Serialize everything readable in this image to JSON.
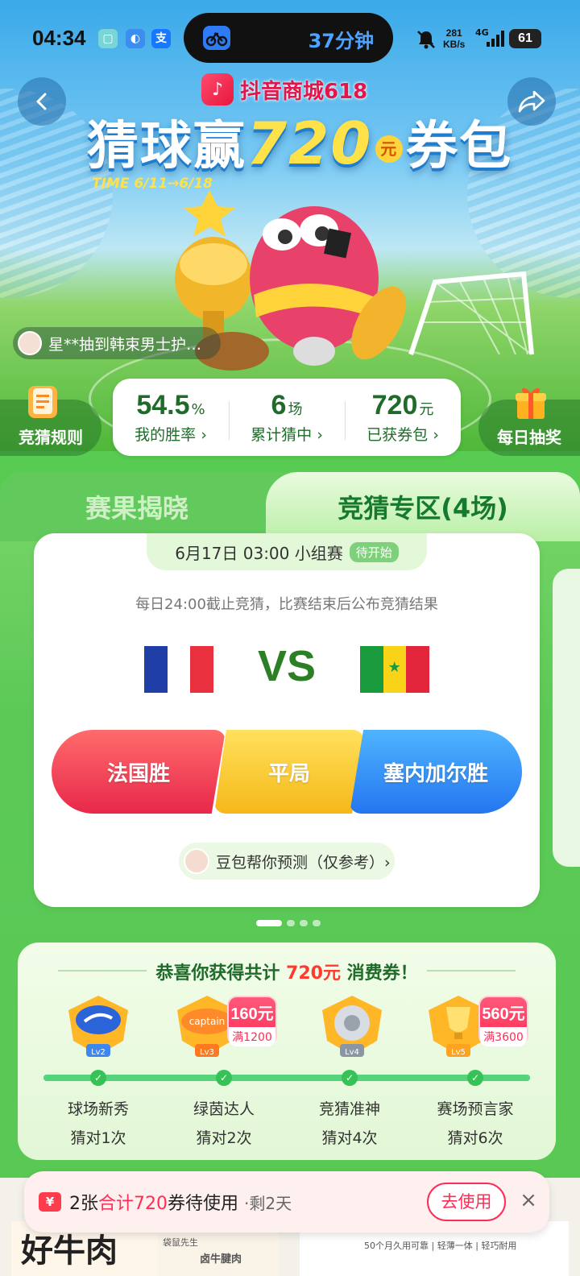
{
  "status_bar": {
    "time": "04:34",
    "timer": "37分钟",
    "network_speed_value": "281",
    "network_speed_unit": "KB/s",
    "network_type": "4G",
    "battery": "61"
  },
  "hero": {
    "brand": "抖音商城618",
    "headline_prefix": "猜球赢",
    "headline_number": "720",
    "headline_yuan": "元",
    "headline_suffix": "券包",
    "time_range": "TIME 6/11→6/18",
    "ticker": "星**抽到韩束男士护…"
  },
  "side_buttons": {
    "rules": "竞猜规则",
    "lottery": "每日抽奖"
  },
  "stats": [
    {
      "value": "54.5",
      "unit": "%",
      "label": "我的胜率 ›"
    },
    {
      "value": "6",
      "unit": "场",
      "label": "累计猜中 ›"
    },
    {
      "value": "720",
      "unit": "元",
      "label": "已获券包 ›"
    }
  ],
  "tabs": {
    "results": "赛果揭晓",
    "guess": "竞猜专区(4场)"
  },
  "match": {
    "datetime": "6月17日 03:00 小组赛",
    "status": "待开始",
    "deadline_note": "每日24:00截止竞猜，比赛结束后公布竞猜结果",
    "vs": "VS",
    "home_win": "法国胜",
    "draw": "平局",
    "away_win": "塞内加尔胜",
    "predict": "豆包帮你预测（仅参考）›"
  },
  "rewards": {
    "title_prefix": "恭喜你获得共计 ",
    "title_amount": "720元",
    "title_suffix": " 消费券！",
    "progress_fraction": 1.0,
    "levels": [
      {
        "badge": "Lv2",
        "name": "球场新秀",
        "requirement": "猜对1次"
      },
      {
        "badge": "Lv3",
        "name": "绿茵达人",
        "requirement": "猜对2次",
        "coupon_amount": "160元",
        "coupon_cond": "满1200"
      },
      {
        "badge": "Lv4",
        "name": "竞猜准神",
        "requirement": "猜对4次"
      },
      {
        "badge": "Lv5",
        "name": "赛场预言家",
        "requirement": "猜对6次",
        "coupon_amount": "560元",
        "coupon_cond": "满3600"
      }
    ]
  },
  "coupon_bar": {
    "icon": "¥",
    "count": "2张",
    "total": "合计720",
    "pending": "券待使用",
    "remaining": "·剩2天",
    "use_button": "去使用",
    "close": "×"
  },
  "shop_preview": {
    "title": "好牛肉",
    "product": "袋鼠先生",
    "product_desc": "卤牛腱肉",
    "slogan": "50个月久用可靠 | 轻薄一体 | 轻巧耐用"
  },
  "colors": {
    "brand_red": "#e2164b",
    "green_dark": "#1f6b2a",
    "accent_red": "#ff2d55",
    "france_blue": "#1f3fa6",
    "france_red": "#e8303f",
    "senegal_green": "#199a3d",
    "senegal_yellow": "#f8d318",
    "senegal_red": "#e2253a"
  }
}
